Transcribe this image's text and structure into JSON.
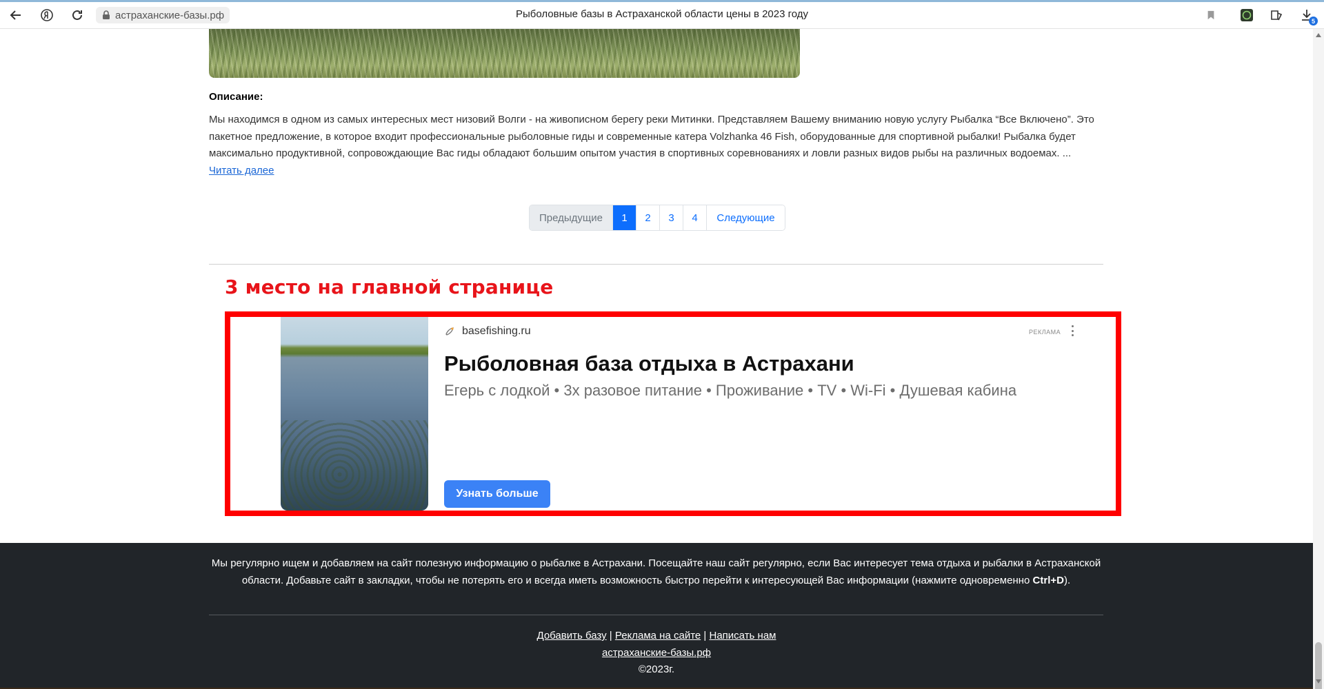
{
  "browser": {
    "url": "астраханские-базы.рф",
    "tab_title": "Рыболовные базы в Астраханской области цены в 2023 году",
    "downloads_badge": "5"
  },
  "description": {
    "heading": "Описание:",
    "text": "Мы находимся в одном из самых интересных мест низовий Волги - на живописном берегу реки Митинки. Представляем Вашему вниманию новую услугу Рыбалка “Все Включено”. Это пакетное предложение, в которое входит профессиональные рыболовные гиды и современные катера Volzhanka 46 Fish, оборудованные для спортивной рыбалки! Рыбалка будет максимально продуктивной, сопровождающие Вас гиды обладают большим опытом участия в спортивных соревнованиях и ловли разных видов рыбы на различных водоемах. ...",
    "read_more": "Читать далее"
  },
  "pagination": {
    "prev": "Предыдущие",
    "pages": [
      "1",
      "2",
      "3",
      "4"
    ],
    "active": "1",
    "next": "Следующие"
  },
  "promo": {
    "title": "3 место на главной странице"
  },
  "ad": {
    "source": "basefishing.ru",
    "label": "РЕКЛАМА",
    "headline": "Рыболовная база отдыха в Астрахани",
    "subline": "Егерь с лодкой • 3х разовое питание • Проживание • TV • Wi-Fi • Душевая кабина",
    "button": "Узнать больше"
  },
  "footer": {
    "info_text": "Мы регулярно ищем и добавляем на сайт полезную информацию о рыбалке в Астрахани. Посещайте наш сайт регулярно, если Вас интересует тема отдыха и рыбалки в Астраханской области. Добавьте сайт в закладки, чтобы не потерять его и всегда иметь возможность быстро перейти к интересующей Вас информации (нажмите одновременно",
    "shortcut": "Ctrl+D",
    "info_tail": ").",
    "link_add": "Добавить базу",
    "link_ads": "Реклама на сайте",
    "link_write": "Написать нам",
    "separator": "|",
    "site_link": "астраханские-базы.рф",
    "copyright": "©2023г."
  },
  "colors": {
    "promo_red": "#e8141a",
    "ad_frame": "#ff0000",
    "ad_button": "#3b82f6",
    "footer_bg": "#212529",
    "pagination_active": "#0d6efd"
  }
}
